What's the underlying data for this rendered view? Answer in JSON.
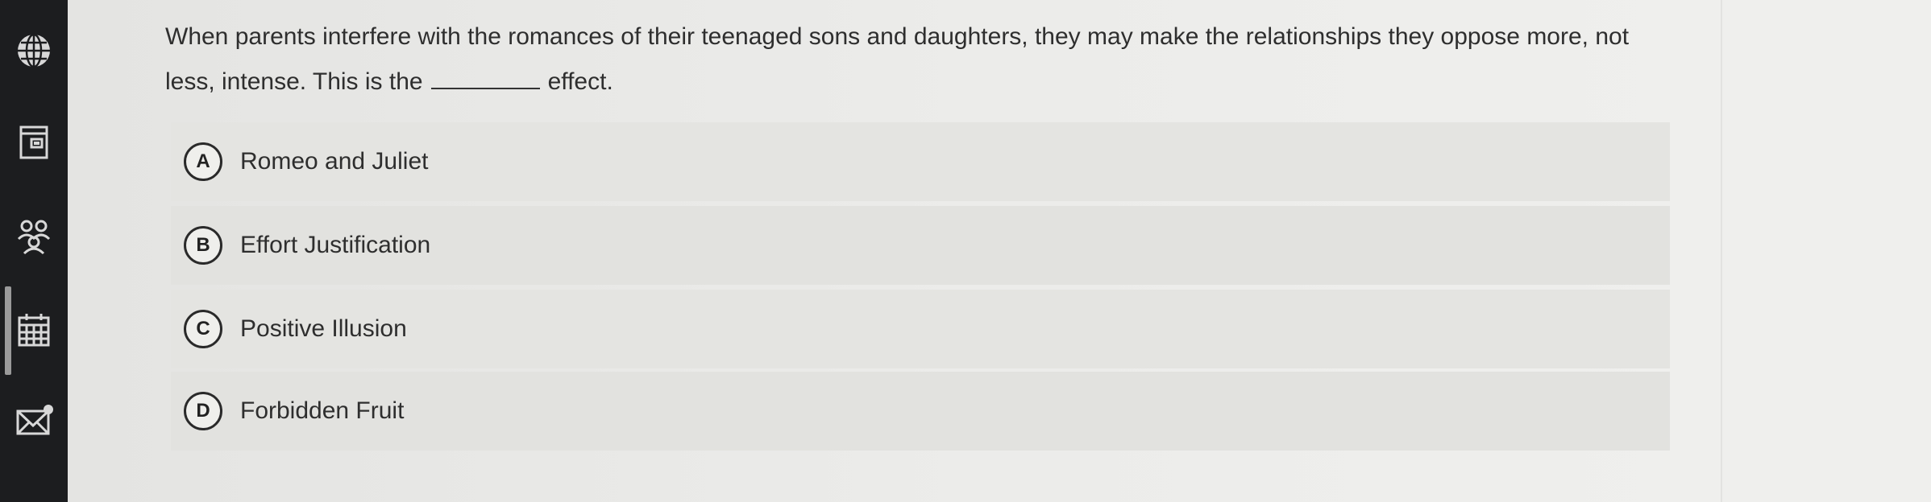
{
  "sidebar": {
    "items": [
      {
        "icon": "globe-icon"
      },
      {
        "icon": "document-icon"
      },
      {
        "icon": "people-icon"
      },
      {
        "icon": "calendar-icon"
      },
      {
        "icon": "mail-icon"
      }
    ],
    "active_index": 3
  },
  "question": {
    "text_before": "When parents interfere with the romances of their teenaged sons and daughters, they may make the relationships they oppose more, not less, intense. This is the",
    "text_after": "effect."
  },
  "choices": [
    {
      "letter": "A",
      "label": "Romeo and Juliet"
    },
    {
      "letter": "B",
      "label": "Effort Justification"
    },
    {
      "letter": "C",
      "label": "Positive Illusion"
    },
    {
      "letter": "D",
      "label": "Forbidden Fruit"
    }
  ],
  "colors": {
    "sidebar": "#1c1d1f",
    "background": "#e9e9e7",
    "option_background": "#e2e2df",
    "text": "#2e2e2e"
  }
}
